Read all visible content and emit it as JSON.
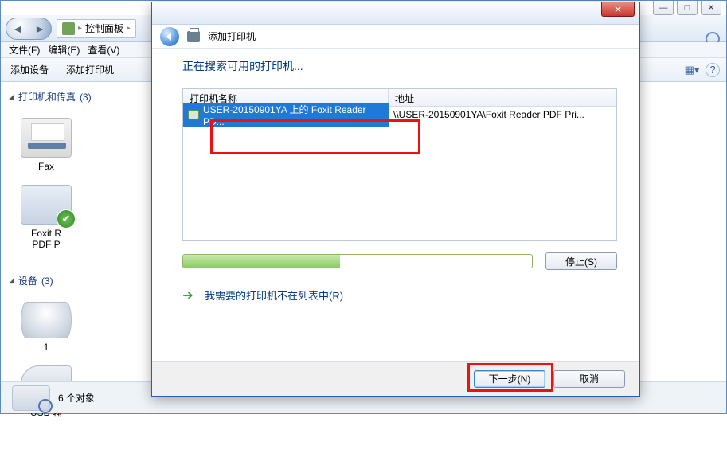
{
  "explorer": {
    "breadcrumb_root": "控制面板",
    "menu": {
      "file": "文件(F)",
      "edit": "编辑(E)",
      "view": "查看(V)"
    },
    "cmd": {
      "add_device": "添加设备",
      "add_printer": "添加打印机"
    },
    "titlebar": {
      "min": "—",
      "max": "□",
      "close": "✕"
    },
    "categories": {
      "printers": {
        "label": "打印机和传真",
        "count": "(3)"
      },
      "devices": {
        "label": "设备",
        "count": "(3)"
      }
    },
    "items": {
      "fax": "Fax",
      "foxit": "Foxit R",
      "foxit2": "PDF P",
      "disk": "1",
      "usb": "USB 输"
    },
    "status": "6 个对象"
  },
  "dialog": {
    "title": "添加打印机",
    "close": "✕",
    "searching": "正在搜索可用的打印机...",
    "columns": {
      "name": "打印机名称",
      "addr": "地址"
    },
    "rows": [
      {
        "name": "USER-20150901YA 上的 Foxit Reader PD...",
        "addr": "\\\\USER-20150901YA\\Foxit Reader PDF Pri..."
      }
    ],
    "stop": "停止(S)",
    "not_listed": "我需要的打印机不在列表中(R)",
    "next": "下一步(N)",
    "cancel": "取消"
  }
}
